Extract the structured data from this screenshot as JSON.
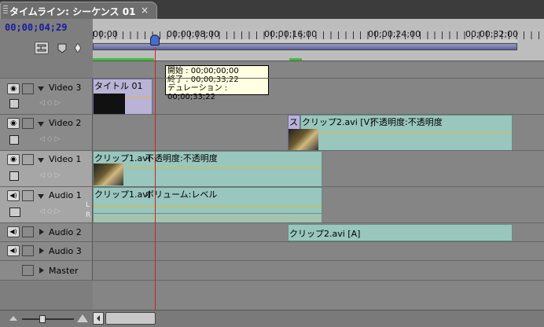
{
  "tab": {
    "title": "タイムライン: シーケンス 01",
    "close": "×"
  },
  "timecode": "00;00;04;29",
  "ruler": {
    "labels": [
      "00;00",
      "00;00;08;00",
      "00;00;16;00",
      "00;00;24;00",
      "00;00;32;00"
    ]
  },
  "tooltip": {
    "start": "開始 : 00;00;00;00",
    "end": "終了 : 00;00;33;22",
    "duration": "デュレーション : 00;00;33;22"
  },
  "tracks": {
    "video3": {
      "label": "Video 3",
      "clip": "タイトル 01"
    },
    "video2": {
      "label": "Video 2",
      "clip": "クリップ2.avi [V]",
      "effect": "不透明度:不透明度",
      "small": "ス"
    },
    "video1": {
      "label": "Video 1",
      "clip": "クリップ1.avi",
      "effect": "不透明度:不透明度"
    },
    "audio1": {
      "label": "Audio 1",
      "clip": "クリップ1.avi",
      "effect": "ボリューム:レベル",
      "ch_l": "L",
      "ch_r": "R"
    },
    "audio2": {
      "label": "Audio 2",
      "clip": "クリップ2.avi [A]"
    },
    "audio3": {
      "label": "Audio 3"
    },
    "master": {
      "label": "Master"
    }
  },
  "colors": {
    "clip": "#99c6bd",
    "title_clip": "#b9b3d6",
    "playhead": "#c22222",
    "timecode": "#1a1aa0"
  }
}
